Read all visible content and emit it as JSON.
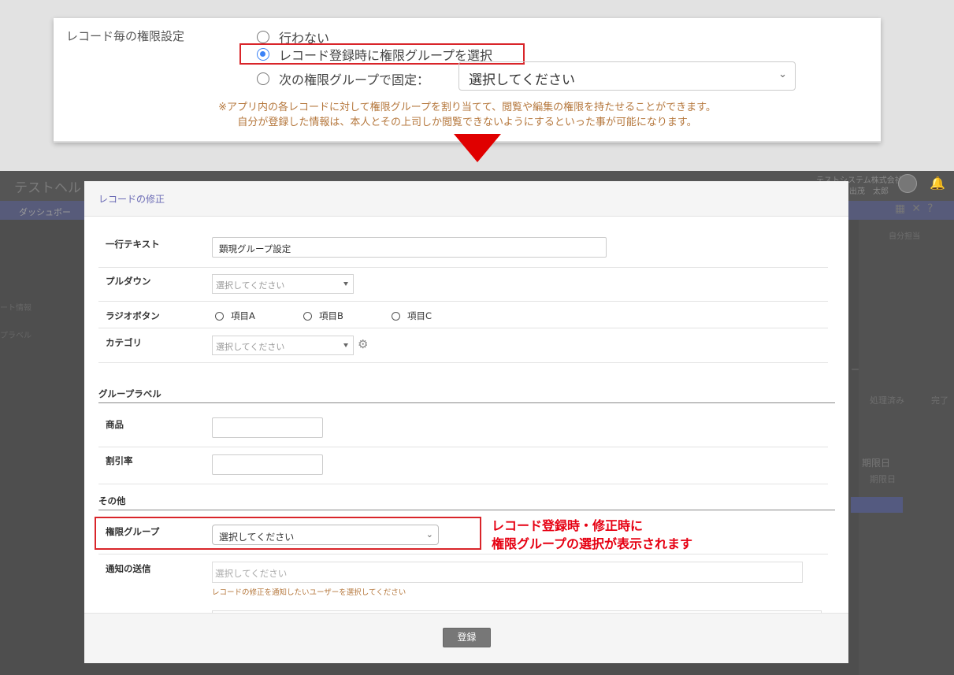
{
  "settings": {
    "label": "レコード毎の権限設定",
    "options": [
      "行わない",
      "レコード登録時に権限グループを選択",
      "次の権限グループで固定："
    ],
    "selected_index": 1,
    "fixed_select_placeholder": "選択してください",
    "note_line1": "※アプリ内の各レコードに対して権限グループを割り当てて、閲覧や編集の権限を持たせることができます。",
    "note_line2": "自分が登録した情報は、本人とその上司しか閲覧できないようにするといった事が可能になります。"
  },
  "background": {
    "app_title": "テストヘル",
    "nav_item": "ダッシュボー",
    "company": "テストシステム株式会社",
    "user": "出茂　太郎",
    "left_text1": "ート情報",
    "left_text2": "プラベル",
    "right1": "自分担当",
    "right2": "処理済み",
    "right3": "完了",
    "right4": "期限日",
    "right5": "期限日",
    "right6": "ー"
  },
  "modal": {
    "title": "レコードの修正",
    "fields": {
      "text_label": "一行テキスト",
      "text_value": "顕現グループ設定",
      "pulldown_label": "プルダウン",
      "pulldown_placeholder": "選択してください",
      "radio_label": "ラジオボタン",
      "radio_options": [
        "項目A",
        "項目B",
        "項目C"
      ],
      "category_label": "カテゴリ",
      "category_placeholder": "選択してください"
    },
    "section_group": "グループラベル",
    "product_label": "商品",
    "discount_label": "割引率",
    "section_other": "その他",
    "permission_label": "権限グループ",
    "permission_placeholder": "選択してください",
    "notify_label": "通知の送信",
    "notify_placeholder": "選択してください",
    "notify_hint": "レコードの修正を通知したいユーザーを選択してください",
    "submit_label": "登録"
  },
  "callout": {
    "line1": "レコード登録時・修正時に",
    "line2": "権限グループの選択が表示されます"
  },
  "colors": {
    "highlight": "#d9252a",
    "arrow": "#e00000",
    "note": "#b5773c",
    "callout": "#e60012",
    "radio_selected": "#3b82f6"
  }
}
